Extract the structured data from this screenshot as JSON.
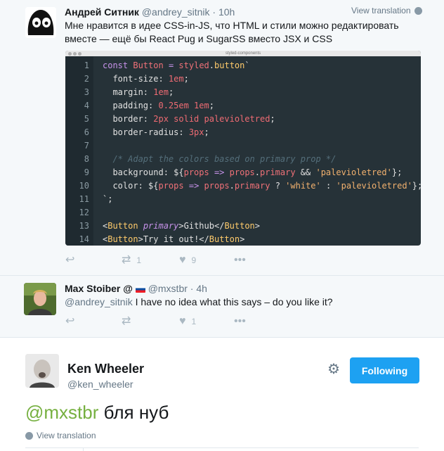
{
  "tweet1": {
    "name": "Андрей Ситник",
    "handle": "@andrey_sitnik",
    "time": "10h",
    "view_translation": "View translation",
    "text_line1": "Мне нравится в идее CSS-in-JS, что HTML и стили можно редактировать",
    "text_line2": "вместе — ещё бы React Pug и SugarSS вместо JSX и CSS",
    "code_window_title": "styled-components",
    "code_lines": [
      {
        "n": "1"
      },
      {
        "n": "2"
      },
      {
        "n": "3"
      },
      {
        "n": "4"
      },
      {
        "n": "5"
      },
      {
        "n": "6"
      },
      {
        "n": "7"
      },
      {
        "n": "8"
      },
      {
        "n": "9"
      },
      {
        "n": "10"
      },
      {
        "n": "11"
      },
      {
        "n": "12"
      },
      {
        "n": "13"
      },
      {
        "n": "14"
      }
    ],
    "retweets": "1",
    "likes": "9"
  },
  "tweet2": {
    "name": "Max Stoiber",
    "handle": "@mxstbr",
    "time": "4h",
    "mention": "@andrey_sitnik",
    "text": " I have no idea what this says – do you like it?",
    "likes": "1"
  },
  "tweet3": {
    "name": "Ken Wheeler",
    "handle": "@ken_wheeler",
    "follow_label": "Following",
    "mention": "@mxstbr",
    "text": " бля нуб",
    "view_translation": "View translation"
  },
  "colors": {
    "accent": "#1da1f2",
    "mention_green": "#76b040",
    "code_bg": "#263238"
  }
}
